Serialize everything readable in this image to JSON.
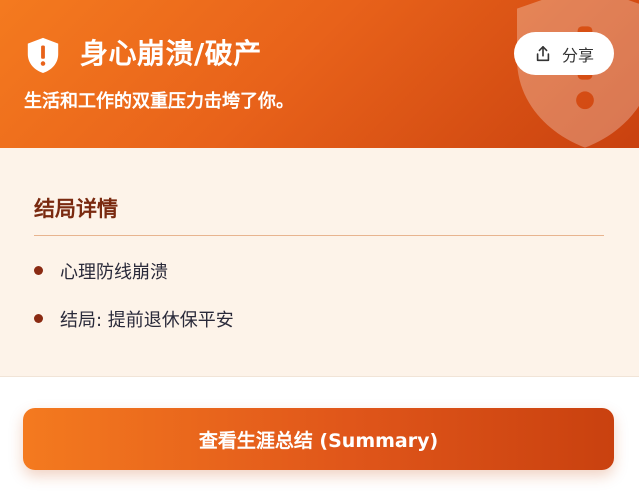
{
  "header": {
    "title": "身心崩溃/破产",
    "subtitle": "生活和工作的双重压力击垮了你。",
    "icon": "shield-alert-icon",
    "share_label": "分享",
    "share_icon": "share-icon",
    "colors": {
      "gradient_start": "#f47a1f",
      "gradient_end": "#c9410f"
    }
  },
  "details": {
    "title": "结局详情",
    "items": [
      {
        "text": "心理防线崩溃"
      },
      {
        "text": "结局: 提前退休保平安"
      }
    ]
  },
  "summary_button": {
    "label": "查看生涯总结 (Summary)"
  }
}
